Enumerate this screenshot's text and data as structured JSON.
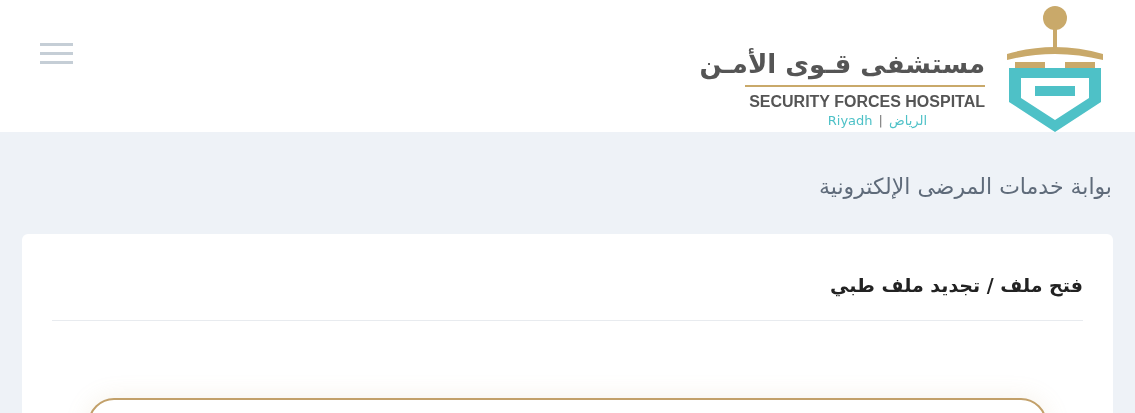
{
  "header": {
    "logo": {
      "name_ar": "مستشفى قـوى الأمـن",
      "name_en": "SECURITY FORCES HOSPITAL",
      "city_en": "Riyadh",
      "separator": "|",
      "city_ar": "الرياض"
    }
  },
  "page_title": "بوابة خدمات المرضى الإلكترونية",
  "card": {
    "title": "فتح ملف / تجديد ملف طبي"
  }
}
